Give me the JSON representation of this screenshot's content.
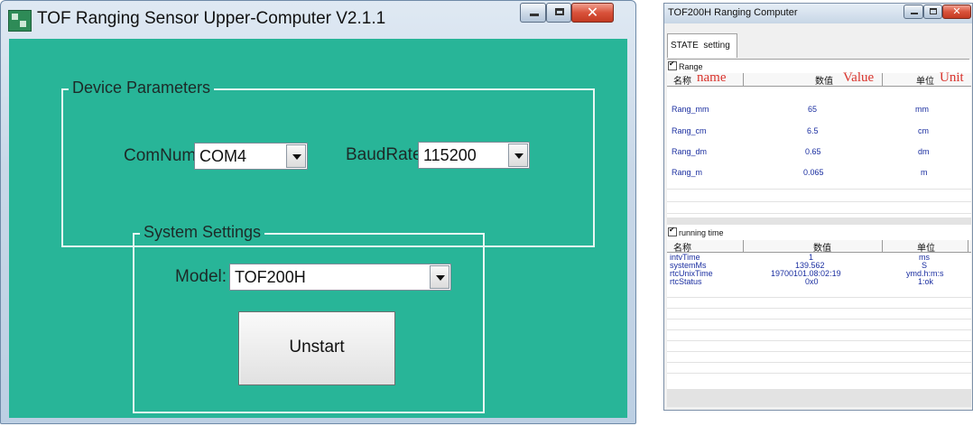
{
  "window1": {
    "title": "TOF Ranging Sensor Upper-Computer V2.1.1",
    "device_parameters": {
      "legend": "Device Parameters",
      "comnum_label": "ComNum:",
      "comnum_value": "COM4",
      "baudrate_label": "BaudRate:",
      "baudrate_value": "115200"
    },
    "system_settings": {
      "legend": "System Settings",
      "model_label": "Model:",
      "model_value": "TOF200H",
      "start_button": "Unstart"
    },
    "colors": {
      "client_bg": "#28b598"
    }
  },
  "window2": {
    "title": "TOF200H Ranging Computer",
    "tabs": [
      "STATE",
      "setting"
    ],
    "range": {
      "checkbox_label": "Range",
      "columns": {
        "name_cn": "名称",
        "name_en": "name",
        "value_cn": "数值",
        "value_en": "Value",
        "unit_cn": "单位",
        "unit_en": "Unit"
      },
      "rows": [
        {
          "name": "Rang_mm",
          "value": "65",
          "unit": "mm"
        },
        {
          "name": "Rang_cm",
          "value": "6.5",
          "unit": "cm"
        },
        {
          "name": "Rang_dm",
          "value": "0.65",
          "unit": "dm"
        },
        {
          "name": "Rang_m",
          "value": "0.065",
          "unit": "m"
        }
      ]
    },
    "running": {
      "checkbox_label": "running time",
      "columns": {
        "name": "名称",
        "value": "数值",
        "unit": "单位"
      },
      "rows": [
        {
          "name": "intvTime",
          "value": "1",
          "unit": "ms"
        },
        {
          "name": "systemMs",
          "value": "139.562",
          "unit": "S"
        },
        {
          "name": "rtcUnixTime",
          "value": "19700101.08:02:19",
          "unit": "ymd.h:m:s"
        },
        {
          "name": "rtcStatus",
          "value": "0x0",
          "unit": "1:ok"
        }
      ]
    }
  }
}
